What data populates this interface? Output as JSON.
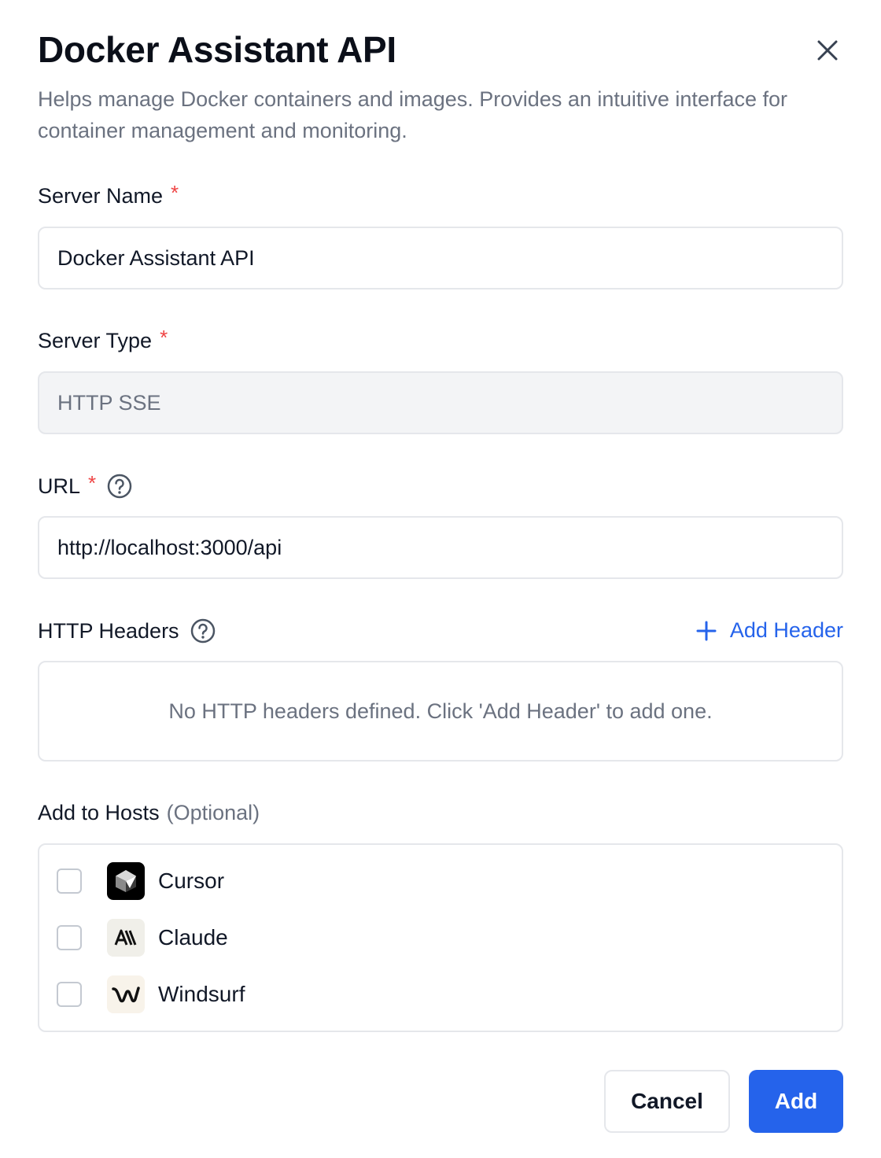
{
  "dialog": {
    "title": "Docker Assistant API",
    "description": "Helps manage Docker containers and images. Provides an intuitive interface for container management and monitoring."
  },
  "form": {
    "server_name": {
      "label": "Server Name",
      "required_mark": "*",
      "value": "Docker Assistant API"
    },
    "server_type": {
      "label": "Server Type",
      "required_mark": "*",
      "value": "HTTP SSE"
    },
    "url": {
      "label": "URL",
      "required_mark": "*",
      "value": "http://localhost:3000/api"
    },
    "http_headers": {
      "label": "HTTP Headers",
      "add_label": "Add Header",
      "empty_text": "No HTTP headers defined. Click 'Add Header' to add one."
    },
    "hosts": {
      "label": "Add to Hosts",
      "optional": "(Optional)",
      "items": [
        {
          "name": "Cursor",
          "icon": "cursor-icon",
          "checked": false
        },
        {
          "name": "Claude",
          "icon": "claude-icon",
          "checked": false
        },
        {
          "name": "Windsurf",
          "icon": "windsurf-icon",
          "checked": false
        }
      ]
    }
  },
  "actions": {
    "cancel": "Cancel",
    "add": "Add"
  },
  "colors": {
    "accent": "#2563eb",
    "required": "#ef4444",
    "muted": "#6b7280",
    "border": "#e5e7eb"
  }
}
